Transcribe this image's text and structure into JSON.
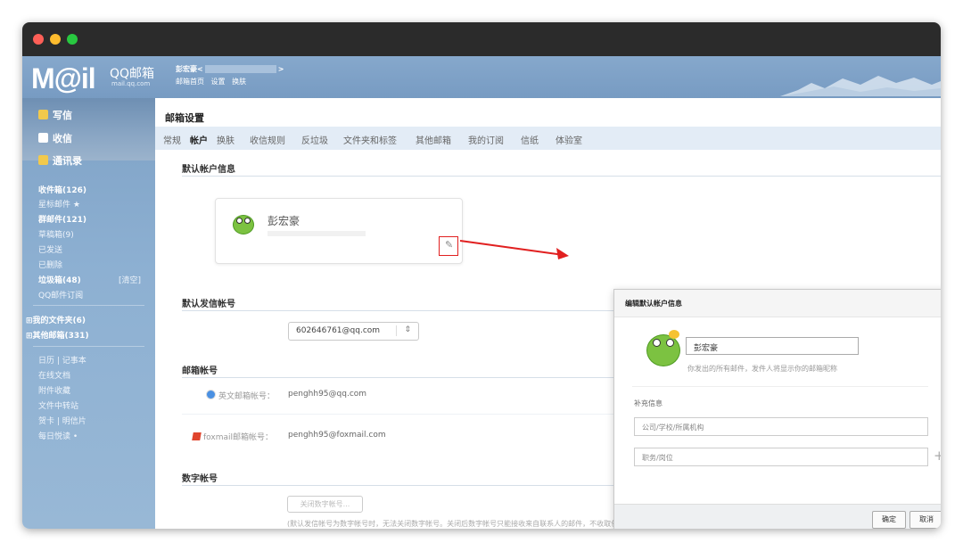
{
  "header": {
    "logo_text": "M@il",
    "logo_brand": "QQ邮箱",
    "logo_domain": "mail.qq.com",
    "user_name": "彭宏豪<",
    "user_suffix": ">",
    "links": [
      "邮箱首页",
      "设置",
      "换肤"
    ]
  },
  "sidebar": {
    "actions": [
      {
        "label": "写信",
        "icon": "pencil-icon"
      },
      {
        "label": "收信",
        "icon": "inbox-icon"
      },
      {
        "label": "通讯录",
        "icon": "contacts-icon"
      }
    ],
    "folders": [
      {
        "label": "收件箱(126)",
        "bold": true
      },
      {
        "label": "星标邮件 ★",
        "bold": false
      },
      {
        "label": "群邮件(121)",
        "bold": true
      },
      {
        "label": "草稿箱(9)",
        "bold": false
      },
      {
        "label": "已发送",
        "bold": false
      },
      {
        "label": "已删除",
        "bold": false
      },
      {
        "label": "垃圾箱(48)",
        "bold": true
      },
      {
        "label": "QQ邮件订阅",
        "bold": false
      }
    ],
    "clear_label": "[清空]",
    "groups": [
      "⊞我的文件夹(6)",
      "⊞其他邮箱(331)"
    ],
    "tools": [
      "日历 | 记事本",
      "在线文档",
      "附件收藏",
      "文件中转站",
      "贺卡 | 明信片",
      "每日悦读 •"
    ]
  },
  "main": {
    "page_title": "邮箱设置",
    "tabs": [
      "常规",
      "帐户",
      "换肤",
      "收信规则",
      "反垃圾",
      "文件夹和标签",
      "其他邮箱",
      "我的订阅",
      "信纸",
      "体验室"
    ],
    "active_tab": "帐户",
    "section_default_info": "默认帐户信息",
    "card_name": "彭宏豪",
    "section_default_sender": "默认发信帐号",
    "sender_value": "602646761@qq.com",
    "sender_arrow": "⇕",
    "section_mail_accounts": "邮箱帐号",
    "accounts": [
      {
        "label": "英文邮箱帐号：",
        "value": "penghh95@qq.com"
      },
      {
        "label": "foxmail邮箱帐号：",
        "value": "penghh95@foxmail.com"
      }
    ],
    "section_digital": "数字帐号",
    "close_digital_btn": "关闭数字帐号...",
    "digital_note": "(默认发信帐号为数字帐号时，无法关闭数字帐号。关闭后数字帐号只能接收来自联系人的邮件，不收取包括邮箱安全邮件在内的其他所有邮件。)"
  },
  "dialog": {
    "title": "编辑默认帐户信息",
    "close": "×",
    "name_value": "彭宏豪",
    "hint": "你发出的所有邮件，发件人将显示你的邮箱昵称",
    "sub_title": "补充信息",
    "company_placeholder": "公司/学校/所属机构",
    "position_placeholder": "职务/岗位",
    "plus": "+",
    "confirm": "确定",
    "cancel": "取消"
  },
  "colors": {
    "accent_red": "#e12020",
    "header_blue": "#7a9ec4",
    "frog_green": "#7cc241"
  }
}
